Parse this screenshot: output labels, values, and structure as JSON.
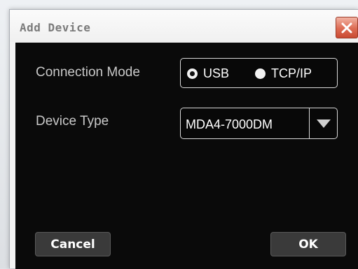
{
  "dialog": {
    "title": "Add Device",
    "close_icon": "close-icon"
  },
  "connection": {
    "label": "Connection Mode",
    "options": [
      {
        "label": "USB",
        "selected": true
      },
      {
        "label": "TCP/IP",
        "selected": false
      }
    ]
  },
  "device_type": {
    "label": "Device Type",
    "value": "MDA4-7000DM",
    "arrow_icon": "triangle-down-icon"
  },
  "buttons": {
    "cancel_label": "Cancel",
    "ok_label": "OK"
  },
  "colors": {
    "body_background": "#0a0a0a",
    "close_button": "#dd6b53",
    "button_background": "#3a3a3a"
  }
}
